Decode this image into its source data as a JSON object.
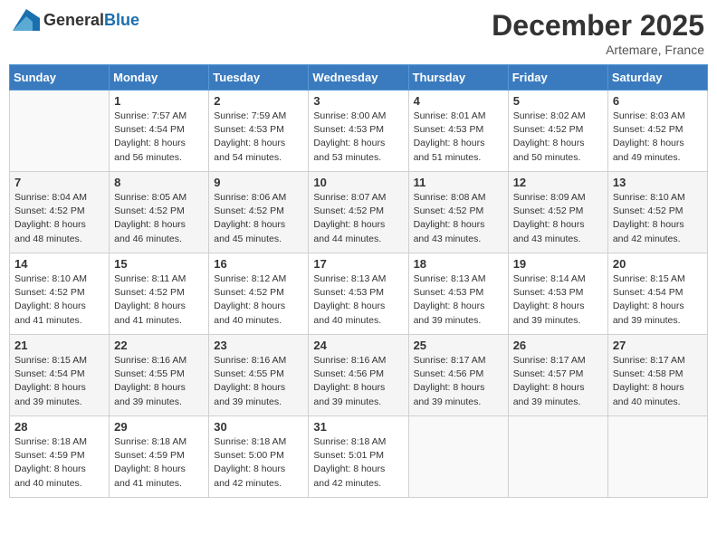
{
  "header": {
    "logo_general": "General",
    "logo_blue": "Blue",
    "title": "December 2025",
    "location": "Artemare, France"
  },
  "days_of_week": [
    "Sunday",
    "Monday",
    "Tuesday",
    "Wednesday",
    "Thursday",
    "Friday",
    "Saturday"
  ],
  "weeks": [
    [
      {
        "day": "",
        "sunrise": "",
        "sunset": "",
        "daylight": ""
      },
      {
        "day": "1",
        "sunrise": "Sunrise: 7:57 AM",
        "sunset": "Sunset: 4:54 PM",
        "daylight": "Daylight: 8 hours and 56 minutes."
      },
      {
        "day": "2",
        "sunrise": "Sunrise: 7:59 AM",
        "sunset": "Sunset: 4:53 PM",
        "daylight": "Daylight: 8 hours and 54 minutes."
      },
      {
        "day": "3",
        "sunrise": "Sunrise: 8:00 AM",
        "sunset": "Sunset: 4:53 PM",
        "daylight": "Daylight: 8 hours and 53 minutes."
      },
      {
        "day": "4",
        "sunrise": "Sunrise: 8:01 AM",
        "sunset": "Sunset: 4:53 PM",
        "daylight": "Daylight: 8 hours and 51 minutes."
      },
      {
        "day": "5",
        "sunrise": "Sunrise: 8:02 AM",
        "sunset": "Sunset: 4:52 PM",
        "daylight": "Daylight: 8 hours and 50 minutes."
      },
      {
        "day": "6",
        "sunrise": "Sunrise: 8:03 AM",
        "sunset": "Sunset: 4:52 PM",
        "daylight": "Daylight: 8 hours and 49 minutes."
      }
    ],
    [
      {
        "day": "7",
        "sunrise": "Sunrise: 8:04 AM",
        "sunset": "Sunset: 4:52 PM",
        "daylight": "Daylight: 8 hours and 48 minutes."
      },
      {
        "day": "8",
        "sunrise": "Sunrise: 8:05 AM",
        "sunset": "Sunset: 4:52 PM",
        "daylight": "Daylight: 8 hours and 46 minutes."
      },
      {
        "day": "9",
        "sunrise": "Sunrise: 8:06 AM",
        "sunset": "Sunset: 4:52 PM",
        "daylight": "Daylight: 8 hours and 45 minutes."
      },
      {
        "day": "10",
        "sunrise": "Sunrise: 8:07 AM",
        "sunset": "Sunset: 4:52 PM",
        "daylight": "Daylight: 8 hours and 44 minutes."
      },
      {
        "day": "11",
        "sunrise": "Sunrise: 8:08 AM",
        "sunset": "Sunset: 4:52 PM",
        "daylight": "Daylight: 8 hours and 43 minutes."
      },
      {
        "day": "12",
        "sunrise": "Sunrise: 8:09 AM",
        "sunset": "Sunset: 4:52 PM",
        "daylight": "Daylight: 8 hours and 43 minutes."
      },
      {
        "day": "13",
        "sunrise": "Sunrise: 8:10 AM",
        "sunset": "Sunset: 4:52 PM",
        "daylight": "Daylight: 8 hours and 42 minutes."
      }
    ],
    [
      {
        "day": "14",
        "sunrise": "Sunrise: 8:10 AM",
        "sunset": "Sunset: 4:52 PM",
        "daylight": "Daylight: 8 hours and 41 minutes."
      },
      {
        "day": "15",
        "sunrise": "Sunrise: 8:11 AM",
        "sunset": "Sunset: 4:52 PM",
        "daylight": "Daylight: 8 hours and 41 minutes."
      },
      {
        "day": "16",
        "sunrise": "Sunrise: 8:12 AM",
        "sunset": "Sunset: 4:52 PM",
        "daylight": "Daylight: 8 hours and 40 minutes."
      },
      {
        "day": "17",
        "sunrise": "Sunrise: 8:13 AM",
        "sunset": "Sunset: 4:53 PM",
        "daylight": "Daylight: 8 hours and 40 minutes."
      },
      {
        "day": "18",
        "sunrise": "Sunrise: 8:13 AM",
        "sunset": "Sunset: 4:53 PM",
        "daylight": "Daylight: 8 hours and 39 minutes."
      },
      {
        "day": "19",
        "sunrise": "Sunrise: 8:14 AM",
        "sunset": "Sunset: 4:53 PM",
        "daylight": "Daylight: 8 hours and 39 minutes."
      },
      {
        "day": "20",
        "sunrise": "Sunrise: 8:15 AM",
        "sunset": "Sunset: 4:54 PM",
        "daylight": "Daylight: 8 hours and 39 minutes."
      }
    ],
    [
      {
        "day": "21",
        "sunrise": "Sunrise: 8:15 AM",
        "sunset": "Sunset: 4:54 PM",
        "daylight": "Daylight: 8 hours and 39 minutes."
      },
      {
        "day": "22",
        "sunrise": "Sunrise: 8:16 AM",
        "sunset": "Sunset: 4:55 PM",
        "daylight": "Daylight: 8 hours and 39 minutes."
      },
      {
        "day": "23",
        "sunrise": "Sunrise: 8:16 AM",
        "sunset": "Sunset: 4:55 PM",
        "daylight": "Daylight: 8 hours and 39 minutes."
      },
      {
        "day": "24",
        "sunrise": "Sunrise: 8:16 AM",
        "sunset": "Sunset: 4:56 PM",
        "daylight": "Daylight: 8 hours and 39 minutes."
      },
      {
        "day": "25",
        "sunrise": "Sunrise: 8:17 AM",
        "sunset": "Sunset: 4:56 PM",
        "daylight": "Daylight: 8 hours and 39 minutes."
      },
      {
        "day": "26",
        "sunrise": "Sunrise: 8:17 AM",
        "sunset": "Sunset: 4:57 PM",
        "daylight": "Daylight: 8 hours and 39 minutes."
      },
      {
        "day": "27",
        "sunrise": "Sunrise: 8:17 AM",
        "sunset": "Sunset: 4:58 PM",
        "daylight": "Daylight: 8 hours and 40 minutes."
      }
    ],
    [
      {
        "day": "28",
        "sunrise": "Sunrise: 8:18 AM",
        "sunset": "Sunset: 4:59 PM",
        "daylight": "Daylight: 8 hours and 40 minutes."
      },
      {
        "day": "29",
        "sunrise": "Sunrise: 8:18 AM",
        "sunset": "Sunset: 4:59 PM",
        "daylight": "Daylight: 8 hours and 41 minutes."
      },
      {
        "day": "30",
        "sunrise": "Sunrise: 8:18 AM",
        "sunset": "Sunset: 5:00 PM",
        "daylight": "Daylight: 8 hours and 42 minutes."
      },
      {
        "day": "31",
        "sunrise": "Sunrise: 8:18 AM",
        "sunset": "Sunset: 5:01 PM",
        "daylight": "Daylight: 8 hours and 42 minutes."
      },
      {
        "day": "",
        "sunrise": "",
        "sunset": "",
        "daylight": ""
      },
      {
        "day": "",
        "sunrise": "",
        "sunset": "",
        "daylight": ""
      },
      {
        "day": "",
        "sunrise": "",
        "sunset": "",
        "daylight": ""
      }
    ]
  ]
}
